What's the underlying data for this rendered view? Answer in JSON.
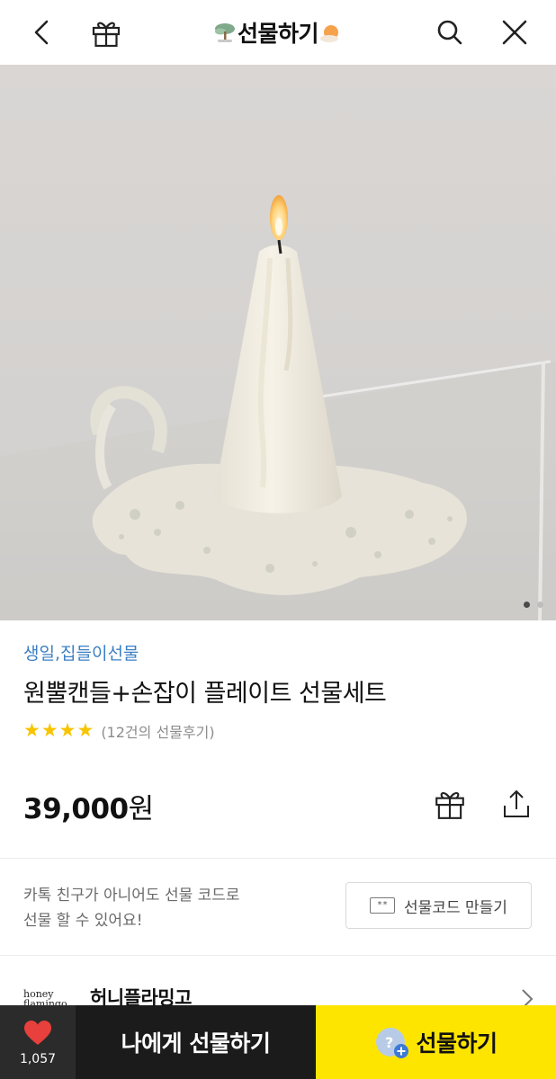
{
  "header": {
    "title": "선물하기",
    "icons": {
      "back": "back-chevron-icon",
      "gift": "gift-box-icon",
      "search": "search-icon",
      "close": "close-icon"
    }
  },
  "product": {
    "image_count": 2,
    "current_image": 1,
    "category": "생일,집들이선물",
    "name": "원뿔캔들+손잡이 플레이트 선물세트",
    "rating": 4,
    "review_text": "(12건의 선물후기)",
    "price_amount": "39,000",
    "price_unit": "원"
  },
  "gift_code": {
    "line1": "카톡 친구가 아니어도 선물 코드로",
    "line2": "선물 할 수 있어요!",
    "icon_text": "**",
    "button_label": "선물코드 만들기"
  },
  "brand": {
    "logo_line1": "honey",
    "logo_line2": "flamingo",
    "name": "허니플라밍고"
  },
  "bottom_bar": {
    "like_count": "1,057",
    "self_gift_label": "나에게 선물하기",
    "gift_label": "선물하기"
  },
  "colors": {
    "accent_yellow": "#fee500",
    "category_blue": "#3b7fc4",
    "heart_red": "#e8403c",
    "star_yellow": "#f8c400"
  }
}
